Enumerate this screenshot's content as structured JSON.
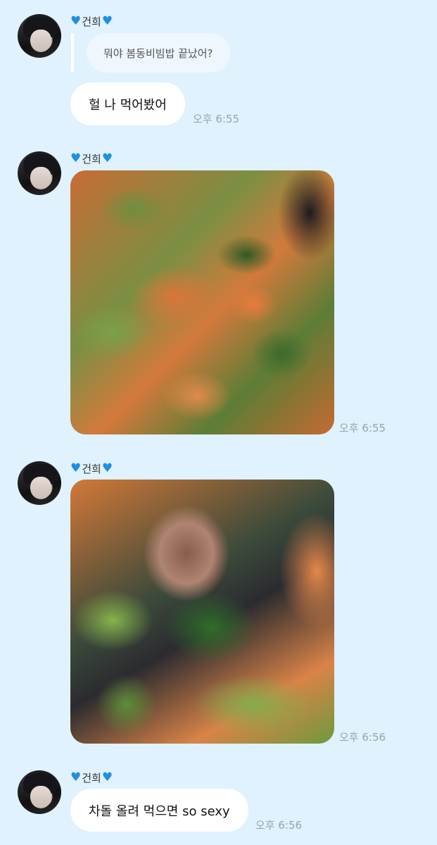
{
  "messages": [
    {
      "sender": "건희",
      "quoted_text": "뭐야 봄동비빔밥 끝났어?",
      "text": "헐 나 먹어봤어",
      "time": "오후 6:55"
    },
    {
      "sender": "건희",
      "image_icon": "photo-kimchi-rice-with-greens",
      "time": "오후 6:55"
    },
    {
      "sender": "건희",
      "image_icon": "photo-brisket-on-rice",
      "time": "오후 6:56"
    },
    {
      "sender": "건희",
      "text": "차돌 올려 먹으면 so sexy",
      "time": "오후 6:56"
    }
  ],
  "colors": {
    "background": "#dff2fd",
    "bubble": "#ffffff",
    "heart": "#1f8fe3",
    "time": "#9aa3ab"
  }
}
